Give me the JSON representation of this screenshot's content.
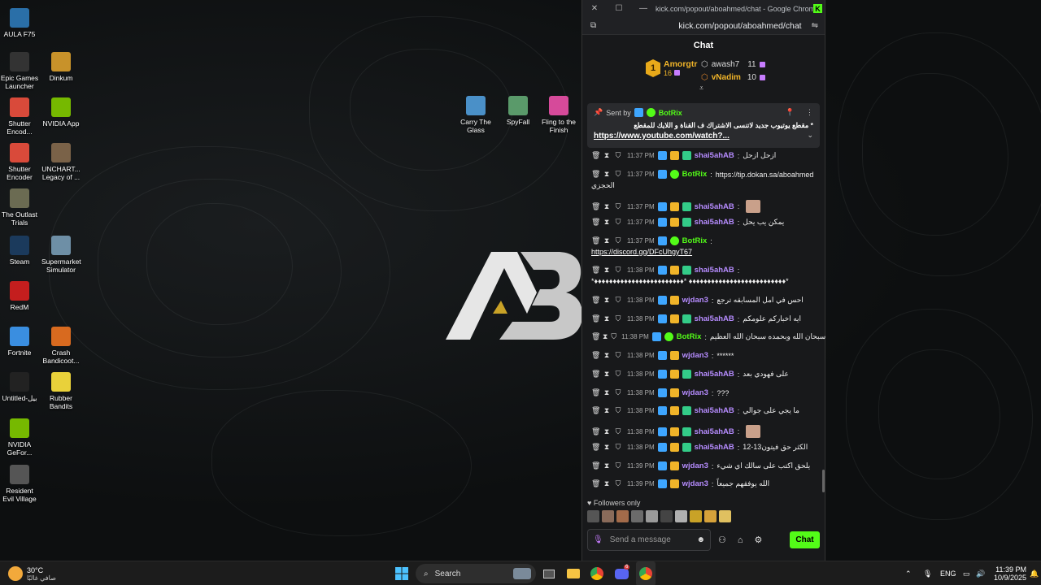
{
  "desktop": {
    "icons_left": [
      {
        "label": "AULA F75",
        "color": "#2a6fa8"
      },
      {
        "label": "Epic Games Launcher",
        "color": "#333333"
      },
      {
        "label": "Shutter Encod...",
        "color": "#d94a3a"
      },
      {
        "label": "Shutter Encoder",
        "color": "#d94a3a"
      },
      {
        "label": "The Outlast Trials",
        "color": "#6b6b52"
      },
      {
        "label": "Steam",
        "color": "#1b3a5c"
      },
      {
        "label": "RedM",
        "color": "#c41e1e"
      },
      {
        "label": "Fortnite",
        "color": "#3a8ee0"
      },
      {
        "label": "Untitled-بيل",
        "color": "#222222"
      },
      {
        "label": "NVIDIA GeFor...",
        "color": "#76b900"
      },
      {
        "label": "Resident Evil Village",
        "color": "#555555"
      }
    ],
    "icons_second": [
      {
        "label": "Dinkum",
        "color": "#c8922a"
      },
      {
        "label": "NVIDIA App",
        "color": "#76b900"
      },
      {
        "label": "UNCHART... Legacy of ...",
        "color": "#7a6248"
      },
      {
        "label": "Supermarket Simulator",
        "color": "#6e8fa6"
      },
      {
        "label": "Crash Bandicoot...",
        "color": "#d86a1f"
      },
      {
        "label": "Rubber Bandits",
        "color": "#e9d13a"
      }
    ],
    "icons_middle": [
      {
        "label": "Carry The Glass",
        "color": "#4a90c8"
      },
      {
        "label": "SpyFall",
        "color": "#5a9a6a"
      },
      {
        "label": "Fling to the Finish",
        "color": "#d64a9a"
      }
    ]
  },
  "chat_window": {
    "title": "kick.com/popout/aboahmed/chat - Google Chrome",
    "url": "kick.com/popout/aboahmed/chat",
    "header": "Chat",
    "leaderboard": {
      "first": {
        "rank": "1",
        "name": "Amorgtr",
        "count": "16"
      },
      "second": {
        "name": "awash7",
        "count": "11"
      },
      "third": {
        "name": "vNadim",
        "count": "10"
      }
    },
    "pinned": {
      "sent_by_label": "Sent by",
      "sender": "BotRix",
      "text": "* مقطع يوتيوب جديد لاتنسى الاشتراك ف القناة و اللايك للمقطع",
      "link": "https://www.youtube.com/watch?..."
    },
    "messages": [
      {
        "time": "11:37 PM",
        "user": "shai5ahAB",
        "color": "#b68cff",
        "text": "ازحل ازحل"
      },
      {
        "time": "11:37 PM",
        "user": "BotRix",
        "color": "#53fc18",
        "text": "https://tip.dokan.sa/aboahmed",
        "text2": "الحجزي"
      },
      {
        "time": "11:37 PM",
        "user": "shai5ahAB",
        "color": "#b68cff",
        "text": ""
      },
      {
        "time": "11:37 PM",
        "user": "shai5ahAB",
        "color": "#b68cff",
        "text": "يمكن يب يحل"
      },
      {
        "time": "11:37 PM",
        "user": "BotRix",
        "color": "#53fc18",
        "text": "",
        "text2": "https://discord.gg/DFcUhgyT67"
      },
      {
        "time": "11:38 PM",
        "user": "shai5ahAB",
        "color": "#b68cff",
        "text": "",
        "text2": "*♦♦♦♦♦♦♦♦♦♦♦♦♦♦♦♦♦♦♦♦♦♦♦♦* ♦♦♦♦♦♦♦♦♦♦♦♦♦♦♦♦♦♦♦♦♦♦♦♦♦♦*"
      },
      {
        "time": "11:38 PM",
        "user": "wjdan3",
        "color": "#b68cff",
        "text": "احس في امل المسابقه ترجع"
      },
      {
        "time": "11:38 PM",
        "user": "shai5ahAB",
        "color": "#b68cff",
        "text": "ايه اخباركم علومكم"
      },
      {
        "time": "11:38 PM",
        "user": "BotRix",
        "color": "#53fc18",
        "text": "سبحان الله وبحمده سبحان الله العظيم"
      },
      {
        "time": "11:38 PM",
        "user": "wjdan3",
        "color": "#b68cff",
        "text": "******"
      },
      {
        "time": "11:38 PM",
        "user": "shai5ahAB",
        "color": "#b68cff",
        "text": "على فهودي بعد"
      },
      {
        "time": "11:38 PM",
        "user": "wjdan3",
        "color": "#b68cff",
        "text": "???"
      },
      {
        "time": "11:38 PM",
        "user": "shai5ahAB",
        "color": "#b68cff",
        "text": "ما يجي على جوالي"
      },
      {
        "time": "11:38 PM",
        "user": "shai5ahAB",
        "color": "#b68cff",
        "text": ""
      },
      {
        "time": "11:38 PM",
        "user": "shai5ahAB",
        "color": "#b68cff",
        "text": "الكثر حق فيتون13-12"
      },
      {
        "time": "11:39 PM",
        "user": "wjdan3",
        "color": "#b68cff",
        "text": "يلحق اكتب على سالك اي شيء"
      },
      {
        "time": "11:39 PM",
        "user": "wjdan3",
        "color": "#b68cff",
        "text": "الله يوفقهم جميعاً"
      }
    ],
    "followers_only": "Followers only",
    "input_placeholder": "Send a message",
    "send_label": "Chat"
  },
  "taskbar": {
    "weather_temp": "30°C",
    "weather_desc": "صافي غالبًا",
    "search_label": "Search",
    "lang": "ENG",
    "time": "11:39 PM",
    "date": "10/9/2025",
    "discord_badge": "6"
  }
}
